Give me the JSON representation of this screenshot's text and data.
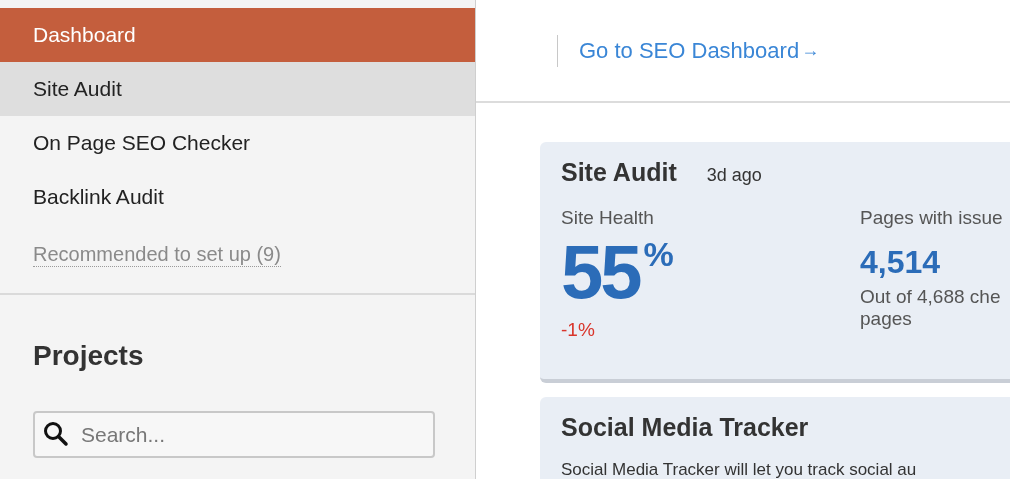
{
  "sidebar": {
    "items": [
      {
        "label": "Dashboard",
        "selected": true,
        "hovered": false
      },
      {
        "label": "Site Audit",
        "selected": false,
        "hovered": true
      },
      {
        "label": "On Page SEO Checker",
        "selected": false,
        "hovered": false
      },
      {
        "label": "Backlink Audit",
        "selected": false,
        "hovered": false
      }
    ],
    "recommended_link": "Recommended to set up (9)",
    "projects": {
      "title": "Projects",
      "search": {
        "placeholder": "Search..."
      }
    }
  },
  "header": {
    "link": "Go to SEO Dashboard",
    "arrow": "→"
  },
  "site_audit_card": {
    "title": "Site Audit",
    "updated": "3d ago",
    "site_health": {
      "label": "Site Health",
      "value": "55",
      "unit": "%",
      "change": "-1%"
    },
    "pages_with_issues": {
      "label": "Pages with issue",
      "value": "4,514",
      "note_lines": [
        "Out of 4,688 che",
        "pages"
      ]
    }
  },
  "social_card": {
    "title": "Social Media Tracker",
    "text": "Social Media Tracker will let you track social au"
  }
}
